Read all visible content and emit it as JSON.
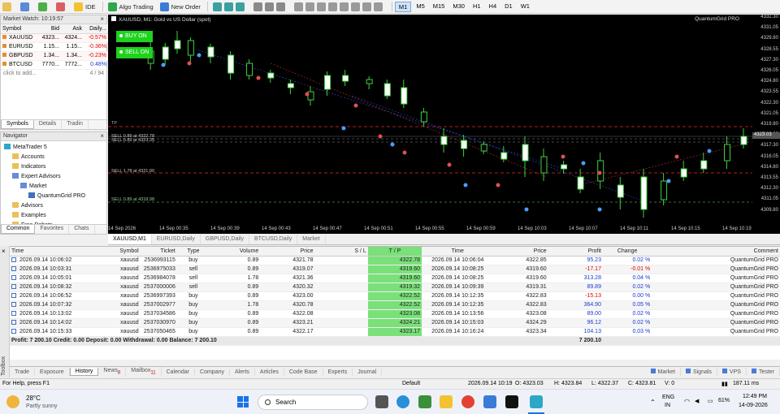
{
  "toolbar": {
    "ide": "IDE",
    "algo": "Algo Trading",
    "new_order": "New Order",
    "timeframes": [
      "M1",
      "M5",
      "M15",
      "M30",
      "H1",
      "H4",
      "D1",
      "W1"
    ],
    "active_tf": "M1"
  },
  "market_watch": {
    "title": "Market Watch: 10:19:57",
    "cols": [
      "Symbol",
      "Bid",
      "Ask",
      "Daily..."
    ],
    "rows": [
      [
        "XAUUSD",
        "4323...",
        "4324...",
        "-0.57%"
      ],
      [
        "EURUSD",
        "1.15...",
        "1.15...",
        "-0.36%"
      ],
      [
        "GBPUSD",
        "1.34...",
        "1.34...",
        "-0.23%"
      ],
      [
        "BTCUSD",
        "7770...",
        "7772...",
        "0.48%"
      ]
    ],
    "add": "click to add...",
    "count": "4 / 94",
    "tabs": [
      "Symbols",
      "Details",
      "Tradin"
    ]
  },
  "navigator": {
    "title": "Navigator",
    "items": [
      "MetaTrader 5",
      "Accounts",
      "Indicators",
      "Expert Advisors",
      "Market",
      "QuantumGrid PRO",
      "Advisors",
      "Examples",
      "Free Robots"
    ],
    "tabs": [
      "Common",
      "Favorites",
      "Chats"
    ]
  },
  "chart": {
    "symbol": "XAUUSD, M1: Gold vs US Dollar (spot)",
    "ea": "QuantumGrid PRO",
    "buy": "BUY ON",
    "sell": "SELL ON",
    "yticks": [
      "4332.30",
      "4331.05",
      "4329.80",
      "4328.55",
      "4327.30",
      "4326.05",
      "4324.80",
      "4323.55",
      "4322.30",
      "4321.05",
      "4319.80",
      "4318.55",
      "4317.30",
      "4316.05",
      "4314.80",
      "4313.55",
      "4312.30",
      "4311.05",
      "4309.80"
    ],
    "price_tag": "4323.03",
    "xticks": [
      "14 Sep 2026",
      "14 Sep 00:35",
      "14 Sep 00:39",
      "14 Sep 00:43",
      "14 Sep 00:47",
      "14 Sep 00:51",
      "14 Sep 00:55",
      "14 Sep 00:59",
      "14 Sep 10:03",
      "14 Sep 10:07",
      "14 Sep 10:11",
      "14 Sep 10:15",
      "14 Sep 10:19"
    ],
    "labels": [
      "TP",
      "SELL 0.89 at 4322.78",
      "SELL 0.89 at 4323.35",
      "SELL 1.78 at 4321.00",
      "SELL 0.89 at 4318.98"
    ],
    "tabs": [
      "XAUUSD,M1",
      "EURUSD,Daily",
      "GBPUSD,Daily",
      "BTCUSD,Daily",
      "Market"
    ]
  },
  "terminal": {
    "cols": [
      "Time",
      "Symbol",
      "Ticket",
      "Type",
      "Volume",
      "Price",
      "S / L",
      "T / P",
      "Time",
      "Price",
      "Profit",
      "Change",
      "Comment"
    ],
    "rows": [
      [
        "2026.09.14 10:06:02",
        "xauusd",
        "2536993115",
        "buy",
        "0.89",
        "4321.78",
        "",
        "4322.78",
        "2026.09.14 10:06:04",
        "4322.85",
        "95.23",
        "0.02 %",
        "QuantumGrid PRO"
      ],
      [
        "2026.09.14 10:03:31",
        "xauusd",
        "2536975033",
        "sell",
        "0.89",
        "4319.07",
        "",
        "4319.60",
        "2026.09.14 10:08:25",
        "4319.60",
        "-17.17",
        "-0.01 %",
        "QuantumGrid PRO"
      ],
      [
        "2026.09.14 10:05:01",
        "xauusd",
        "2536984078",
        "sell",
        "1.78",
        "4321.36",
        "",
        "4319.60",
        "2026.09.14 10:08:25",
        "4319.60",
        "313.28",
        "0.04 %",
        "QuantumGrid PRO"
      ],
      [
        "2026.09.14 10:08:32",
        "xauusd",
        "2537000006",
        "sell",
        "0.89",
        "4320.32",
        "",
        "4319.32",
        "2026.09.14 10:09:39",
        "4319.31",
        "89.89",
        "0.02 %",
        "QuantumGrid PRO"
      ],
      [
        "2026.09.14 10:06:52",
        "xauusd",
        "2536997393",
        "buy",
        "0.89",
        "4323.00",
        "",
        "4322.52",
        "2026.09.14 10:12:35",
        "4322.83",
        "-15.13",
        "0.00 %",
        "QuantumGrid PRO"
      ],
      [
        "2026.09.14 10:07:32",
        "xauusd",
        "2537002977",
        "buy",
        "1.78",
        "4320.78",
        "",
        "4322.52",
        "2026.09.14 10:12:35",
        "4322.83",
        "364.90",
        "0.05 %",
        "QuantumGrid PRO"
      ],
      [
        "2026.09.14 10:13:02",
        "xauusd",
        "2537034586",
        "buy",
        "0.89",
        "4322.08",
        "",
        "4323.08",
        "2026.09.14 10:13:56",
        "4323.08",
        "89.00",
        "0.02 %",
        "QuantumGrid PRO"
      ],
      [
        "2026.09.14 10:14:02",
        "xauusd",
        "2537030970",
        "buy",
        "0.89",
        "4323.21",
        "",
        "4324.21",
        "2026.09.14 10:15:03",
        "4324.29",
        "96.12",
        "0.02 %",
        "QuantumGrid PRO"
      ],
      [
        "2026.09.14 10:15:33",
        "xauusd",
        "2537050465",
        "buy",
        "0.89",
        "4322.17",
        "",
        "4323.17",
        "2026.09.14 10:16:24",
        "4323.34",
        "104.13",
        "0.03 %",
        "QuantumGrid PRO"
      ]
    ],
    "summary": "Profit: 7 200.10  Credit: 0.00  Deposit: 0.00  Withdrawal: 0.00  Balance: 7 200.10",
    "summary_total": "7 200.10",
    "tabs": [
      "Trade",
      "Exposure",
      "History",
      "News",
      "Mailbox",
      "Calendar",
      "Company",
      "Alerts",
      "Articles",
      "Code Base",
      "Experts",
      "Journal"
    ],
    "news_badge": "8",
    "mail_badge": "11",
    "active_tab": "History",
    "right_tabs": [
      "Market",
      "Signals",
      "VPS",
      "Tester"
    ],
    "toolbox": "Toolbox"
  },
  "status": {
    "help": "For Help, press F1",
    "profile": "Default",
    "datetime": "2026.09.14 10:19",
    "open": "O: 4323.03",
    "high": "H: 4323.84",
    "low": "L: 4322.37",
    "close": "C: 4323.81",
    "vol": "V: 0",
    "traffic": "187.11 ms"
  },
  "taskbar": {
    "temp": "28°C",
    "weather": "Partly sunny",
    "search": "Search",
    "lang1": "ENG",
    "lang2": "IN",
    "battery": "61%",
    "time": "12:49 PM",
    "date": "14-09-2026"
  }
}
